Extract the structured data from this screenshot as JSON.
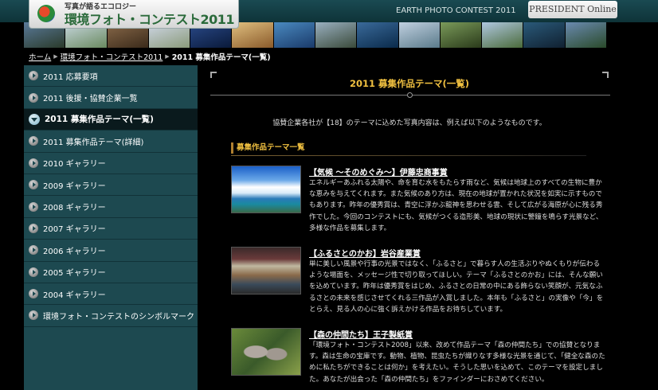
{
  "header": {
    "logo_subtitle": "写真が語るエコロジー",
    "logo_title": "環境フォト・コンテスト2011",
    "earth_text": "EARTH PHOTO CONTEST 2011",
    "president_label": "PRESIDENT Online"
  },
  "breadcrumb": {
    "home": "ホーム",
    "contest": "環境フォト・コンテスト2011",
    "current": "2011 募集作品テーマ(一覧)"
  },
  "sidebar": {
    "items": [
      {
        "label": "2011 応募要項"
      },
      {
        "label": "2011 後援・協賛企業一覧"
      },
      {
        "label": "2011 募集作品テーマ(一覧)",
        "active": true
      },
      {
        "label": "2011 募集作品テーマ(詳細)"
      },
      {
        "label": "2010 ギャラリー"
      },
      {
        "label": "2009 ギャラリー"
      },
      {
        "label": "2008 ギャラリー"
      },
      {
        "label": "2007 ギャラリー"
      },
      {
        "label": "2006 ギャラリー"
      },
      {
        "label": "2005 ギャラリー"
      },
      {
        "label": "2004 ギャラリー"
      },
      {
        "label": "環境フォト・コンテストのシンボルマーク"
      }
    ]
  },
  "main": {
    "title": "2011 募集作品テーマ(一覧)",
    "intro": "協賛企業各社が【18】のテーマに込めた写真内容は、例えば以下のようなものです。",
    "list_heading": "募集作品テーマ一覧",
    "themes": [
      {
        "title": "【気候 ～そのめぐみ～】伊藤忠商事賞",
        "description": "エネルギーあふれる太陽や、命を育む水をもたらす雨など、気候は地球上のすべての生物に豊かな恵みを与えてくれます。また気候のあり方は、現在の地球が置かれた状況を如実に示すものでもあります。昨年の優秀賞は、青空に浮かぶ龍神を思わせる雲、そして広がる海原が心に残る秀作でした。今回のコンテストにも、気候がつくる造形美、地球の現状に警鐘を鳴らす光景など、多様な作品を募集します。"
      },
      {
        "title": "【ふるさとのかお】岩谷産業賞",
        "description": "単に美しい風景や行事の光景ではなく、「ふるさと」で暮らす人の生活ぶりやぬくもりが伝わるような場面を、メッセージ性で切り取ってほしい。テーマ「ふるさとのかお」には、そんな願いを込めています。昨年は優秀賞をはじめ、ふるさとの日常の中にある飾らない笑顔が、元気なふるさとの未来を感じさせてくれる三作品が入賞しました。本年も「ふるさと」の実像や「今」をとらえ、見る人の心に強く訴えかける作品をお待ちしています。"
      },
      {
        "title": "【森の仲間たち】王子製紙賞",
        "description": "「環境フォト・コンテスト2008」以来、改めて作品テーマ「森の仲間たち」での協賛となります。森は生命の宝庫です。動物、植物、昆虫たちが織りなす多様な光景を通じて、「健全な森のために私たちができることは何か」を考えたい。そうした思いを込めて、このテーマを設定しました。あなたが出会った「森の仲間たち」をファインダーにおさめてください。"
      }
    ]
  },
  "colors": {
    "accent_gold": "#f0c040",
    "sidebar_bg": "#1d4950",
    "header_bg": "#0e3338"
  }
}
